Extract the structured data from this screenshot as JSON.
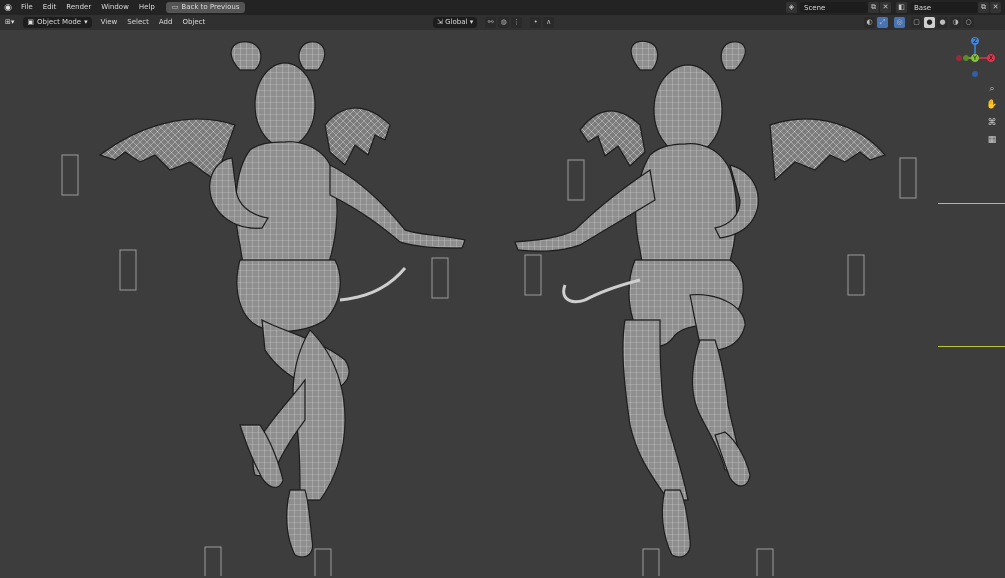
{
  "topbar": {
    "menus": [
      "File",
      "Edit",
      "Render",
      "Window",
      "Help"
    ],
    "back_label": "Back to Previous",
    "scene_label": "Scene",
    "viewlayer_label": "Base"
  },
  "header": {
    "mode_label": "Object Mode",
    "menus": [
      "View",
      "Select",
      "Add",
      "Object"
    ],
    "orientation_label": "Global"
  },
  "gizmo": {
    "z_label": "Z",
    "y_label": "Y",
    "x_label": "X",
    "colors": {
      "x": "#e4324a",
      "y": "#86c13b",
      "z": "#3d88e2"
    }
  },
  "viewport": {
    "wire_color": "#d9d9d9",
    "mesh_fill": "#8e8e8e"
  }
}
